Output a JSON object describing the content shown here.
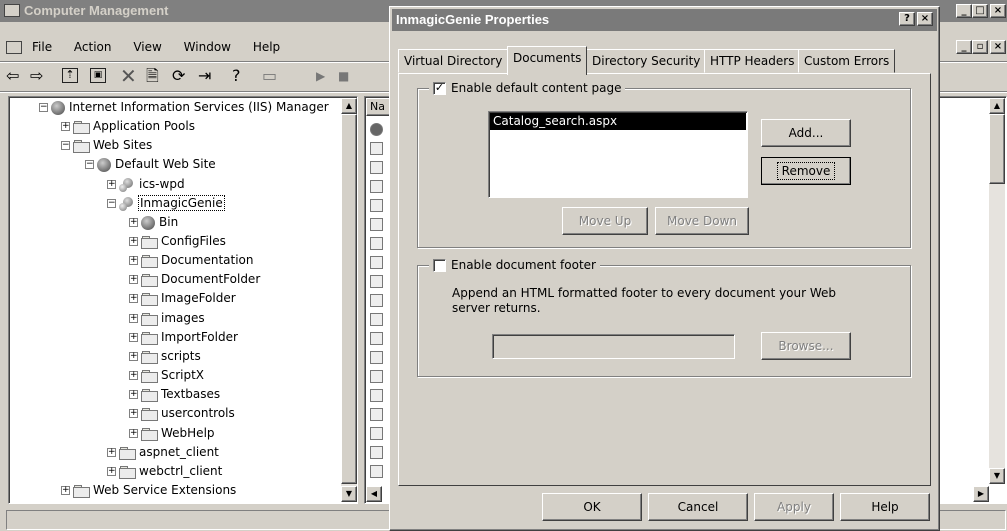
{
  "main_window": {
    "title": "Computer Management",
    "menu": [
      "File",
      "Action",
      "View",
      "Window",
      "Help"
    ],
    "tree": [
      {
        "label": "Internet Information Services (IIS) Manager",
        "icon": "iis-icon",
        "expand": "-"
      },
      {
        "label": "Application Pools",
        "icon": "folder-icon",
        "expand": "+"
      },
      {
        "label": "Web Sites",
        "icon": "folder-icon",
        "expand": "-"
      },
      {
        "label": "Default Web Site",
        "icon": "globe-icon",
        "expand": "-"
      },
      {
        "label": "ics-wpd",
        "icon": "website-icon",
        "expand": "+"
      },
      {
        "label": "InmagicGenie",
        "icon": "website-icon",
        "expand": "-"
      },
      {
        "label": "Bin",
        "icon": "globe-icon",
        "expand": "+"
      },
      {
        "label": "ConfigFiles",
        "icon": "folder-icon",
        "expand": "+"
      },
      {
        "label": "Documentation",
        "icon": "folder-icon",
        "expand": "+"
      },
      {
        "label": "DocumentFolder",
        "icon": "folder-icon",
        "expand": "+"
      },
      {
        "label": "ImageFolder",
        "icon": "folder-icon",
        "expand": "+"
      },
      {
        "label": "images",
        "icon": "folder-icon",
        "expand": "+"
      },
      {
        "label": "ImportFolder",
        "icon": "folder-icon",
        "expand": "+"
      },
      {
        "label": "scripts",
        "icon": "folder-icon",
        "expand": "+"
      },
      {
        "label": "ScriptX",
        "icon": "folder-icon",
        "expand": "+"
      },
      {
        "label": "Textbases",
        "icon": "folder-icon",
        "expand": "+"
      },
      {
        "label": "usercontrols",
        "icon": "folder-icon",
        "expand": "+"
      },
      {
        "label": "WebHelp",
        "icon": "folder-icon",
        "expand": "+"
      },
      {
        "label": "aspnet_client",
        "icon": "folder-icon",
        "expand": "+"
      },
      {
        "label": "webctrl_client",
        "icon": "folder-icon",
        "expand": "+"
      },
      {
        "label": "Web Service Extensions",
        "icon": "folder-icon",
        "expand": "+"
      }
    ],
    "list_header": "Na"
  },
  "dialog": {
    "title": "InmagicGenie Properties",
    "title_buttons": [
      "?",
      "×"
    ],
    "tabs": [
      "Virtual Directory",
      "Documents",
      "Directory Security",
      "HTTP Headers",
      "Custom Errors"
    ],
    "selected_tab": "Documents",
    "default_content": {
      "checkbox_label": "Enable default content page",
      "checked": true,
      "items": [
        "Catalog_search.aspx"
      ],
      "add_label": "Add...",
      "remove_label": "Remove",
      "move_up_label": "Move Up",
      "move_down_label": "Move Down"
    },
    "footer": {
      "checkbox_label": "Enable document footer",
      "checked": false,
      "description": "Append an HTML formatted footer to every document your Web server returns.",
      "path_value": "",
      "browse_label": "Browse..."
    },
    "buttons": {
      "ok": "OK",
      "cancel": "Cancel",
      "apply": "Apply",
      "help": "Help"
    }
  }
}
